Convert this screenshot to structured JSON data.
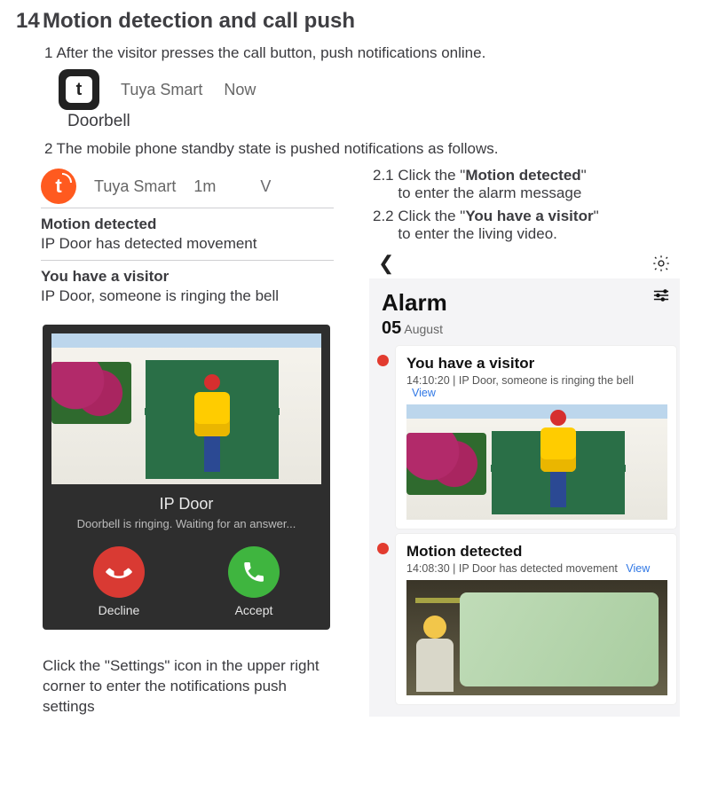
{
  "section": {
    "number": "14",
    "title": "Motion detection and call push"
  },
  "step1": {
    "num": "1",
    "text": "After the visitor presses the call button, push notifications online."
  },
  "notif_line": {
    "app": "Tuya Smart",
    "time": "Now",
    "title": "Doorbell"
  },
  "step2": {
    "num": "2",
    "text": "The mobile phone standby state is pushed notifications  as follows."
  },
  "round_notif": {
    "app": "Tuya Smart",
    "time": "1m",
    "chev": "V"
  },
  "notif_cards": [
    {
      "title": "Motion detected",
      "body": "IP Door has detected movement"
    },
    {
      "title": "You have a visitor",
      "body": "IP Door, someone is ringing the bell"
    }
  ],
  "sub1": {
    "num": "2.1",
    "pre": "Click the \"",
    "bold": "Motion detected",
    "post": "\"",
    "line2": "to enter the alarm message"
  },
  "sub2": {
    "num": "2.2",
    "pre": "Click the \"",
    "bold": "You have a visitor",
    "post": "\"",
    "line2": "to enter the living video."
  },
  "calling": {
    "title": "IP Door",
    "subtitle": "Doorbell is ringing. Waiting for an answer...",
    "decline": "Decline",
    "accept": "Accept"
  },
  "hint": "Click the \"Settings\" icon in the upper right corner to enter the notifications push settings",
  "alarm": {
    "heading": "Alarm",
    "date_day": "05",
    "date_month": "August",
    "items": [
      {
        "title": "You have a visitor",
        "time": "14:10:20",
        "desc": "IP Door, someone is ringing the bell",
        "view": "View",
        "kind": "outdoor"
      },
      {
        "title": "Motion detected",
        "time": "14:08:30",
        "desc": "IP Door has detected movement",
        "view": "View",
        "kind": "indoor"
      }
    ]
  }
}
